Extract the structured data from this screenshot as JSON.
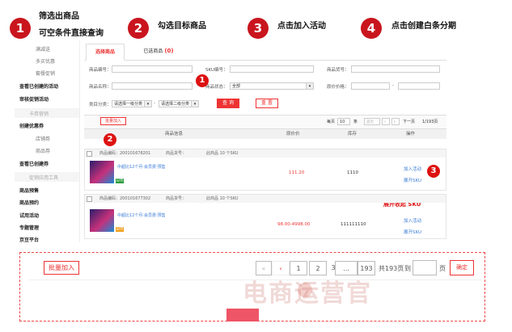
{
  "steps": [
    {
      "num": "1",
      "text": "筛选出商品",
      "text2": "可空条件直接查询"
    },
    {
      "num": "2",
      "text": "勾选目标商品"
    },
    {
      "num": "3",
      "text": "点击加入活动"
    },
    {
      "num": "4",
      "text": "点击创建白条分期"
    }
  ],
  "sidebar": {
    "items": [
      "满减送",
      "多买优惠",
      "套餐促销",
      "查看已创建的活动",
      "审核促销活动",
      "卡券营销",
      "创建优惠券",
      "店铺券",
      "商品券",
      "查看已创建券",
      "促销应用工具",
      "商品预售",
      "商品预约",
      "试用活动",
      "专题管理",
      "京豆平台"
    ]
  },
  "tabs": {
    "select": "选择商品",
    "selected": "已选商品",
    "selected_count": "(0)"
  },
  "filters": {
    "product_id": "商品编号：",
    "sku_id": "SKU编号：",
    "product_no": "商品货号：",
    "product_name": "商品名称：",
    "product_status": "商品状态：",
    "status_value": "全部",
    "price_range": "原价价格：",
    "dash": "-",
    "category": "类目分类：",
    "cat1": "请选择一级分类",
    "cat2": "请选择二级分类",
    "query": "查 询",
    "reset": "重 置"
  },
  "toolbar": {
    "batch_add": "批量加入",
    "per_page": "每页",
    "per_page_value": "10",
    "unit": "条",
    "first": "首页",
    "prev": "上一页",
    "next": "下一页",
    "page_info": "1/193页"
  },
  "table": {
    "headers": [
      "商品信息",
      "原价价",
      "库存",
      "操作"
    ],
    "rows": [
      {
        "code": "商品编码：200101678201",
        "no": "商品货号：",
        "skus": "此商品 10 个SKU",
        "title": "中超比12个月·会员费·预售",
        "price": "111.20",
        "stock": "1110",
        "action1": "加入活动",
        "action2": "展开SKU",
        "tag": "自营",
        "tag_color": "#2c9c3c"
      },
      {
        "code": "商品编码：200101677302",
        "no": "商品货号：",
        "skus": "此商品 10 个SKU",
        "title": "中超比12个月·会员费·预售",
        "price": "98.00-4998.00",
        "stock": "111111110",
        "action1": "加入活动",
        "action2": "展开SKU",
        "tag": "自营",
        "tag_color": "#f0a020"
      }
    ]
  },
  "annotations": {
    "expand_sku": "展开收起 SKU"
  },
  "bottom": {
    "batch_add": "批量加入",
    "pages": [
      "«",
      "‹",
      "1",
      "2",
      "3",
      "...",
      "193",
      "»"
    ],
    "total": "共193页",
    "goto": "到",
    "page": "页",
    "confirm": "确定"
  },
  "watermark": "电商运营官",
  "colors": {
    "accent": "#c9151e",
    "brand_red": "#e33",
    "link": "#3a7bd5"
  }
}
